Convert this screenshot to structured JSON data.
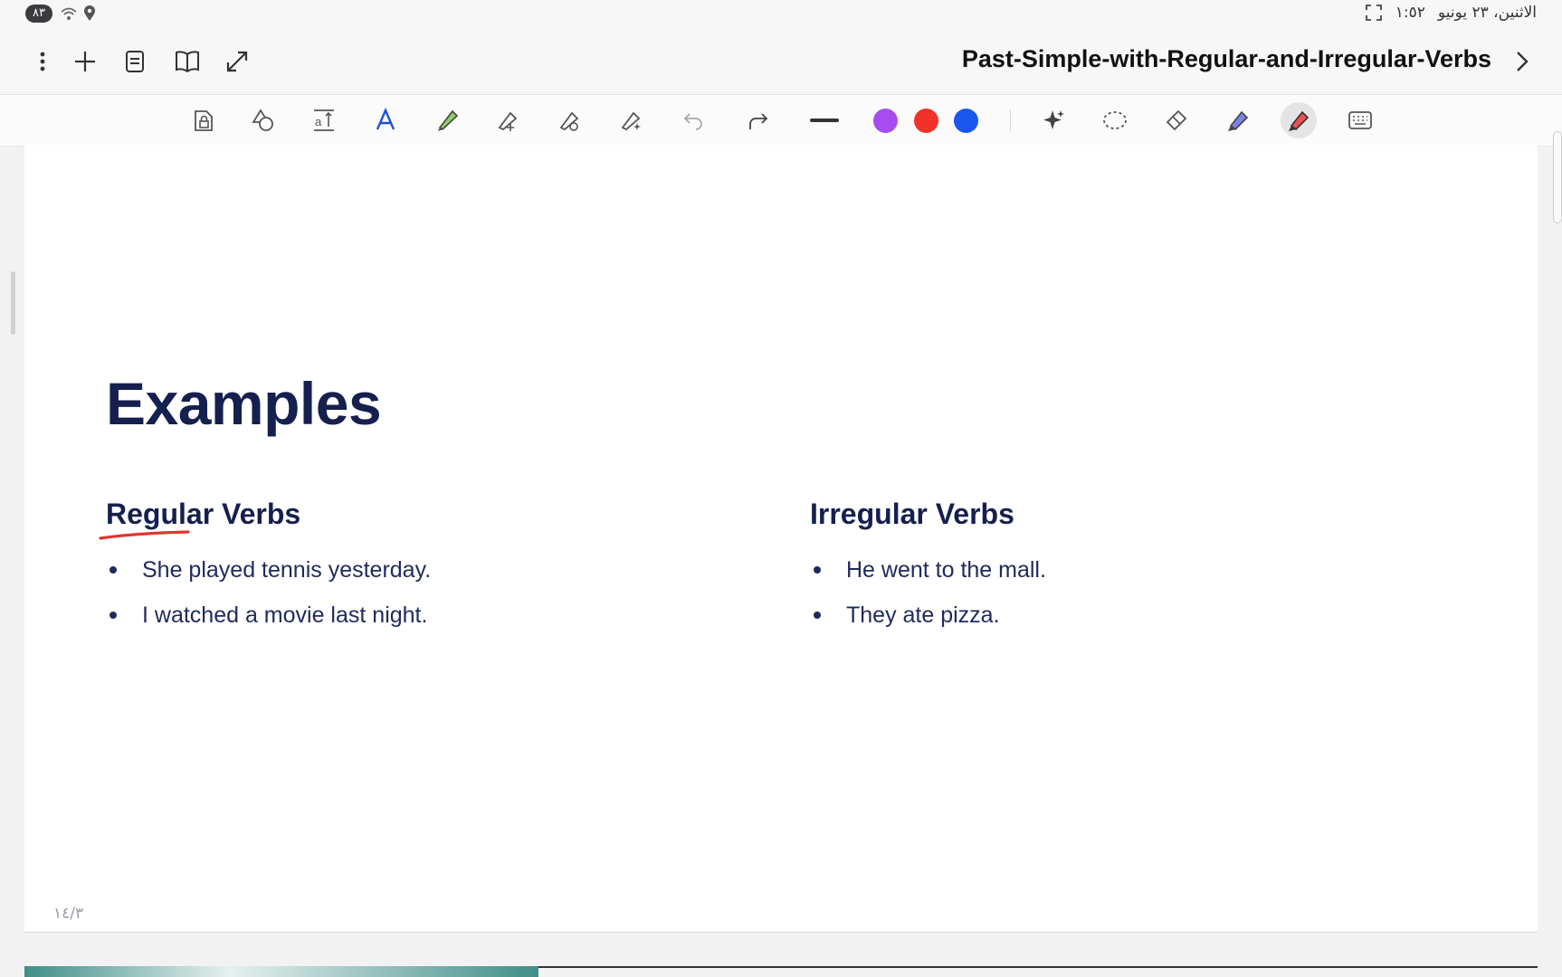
{
  "status_bar": {
    "battery": "٨٣",
    "datetime": "الاثنين، ٢٣ يونيو",
    "time": "١:٥٢"
  },
  "header": {
    "title": "Past-Simple-with-Regular-and-Irregular-Verbs",
    "icons": [
      "more-vertical-icon",
      "add-icon",
      "page-outline-icon",
      "book-view-icon",
      "expand-icon",
      "chevron-right-icon"
    ]
  },
  "toolbar": {
    "tools": [
      "read-only-lock-icon",
      "shapes-icon",
      "text-tool-icon",
      "handwriting-icon",
      "highlighter-icon",
      "pen-icon",
      "calligraphy-pen-icon",
      "magic-pen-icon",
      "undo-icon",
      "redo-icon",
      "stroke-width-icon",
      "ai-sparkle-icon",
      "lasso-icon",
      "eraser-icon",
      "marker-icon",
      "pen-active-icon",
      "keyboard-icon"
    ],
    "colors": [
      "#a64cf0",
      "#f2322a",
      "#1a56f0"
    ]
  },
  "slide": {
    "heading": "Examples",
    "regular": {
      "title": "Regular Verbs",
      "items": [
        "She played tennis yesterday.",
        "I watched a movie last night."
      ]
    },
    "irregular": {
      "title": "Irregular Verbs",
      "items": [
        "He went to the mall.",
        "They ate pizza."
      ]
    },
    "page_number": "١٤/٣"
  },
  "progress": 0.34
}
